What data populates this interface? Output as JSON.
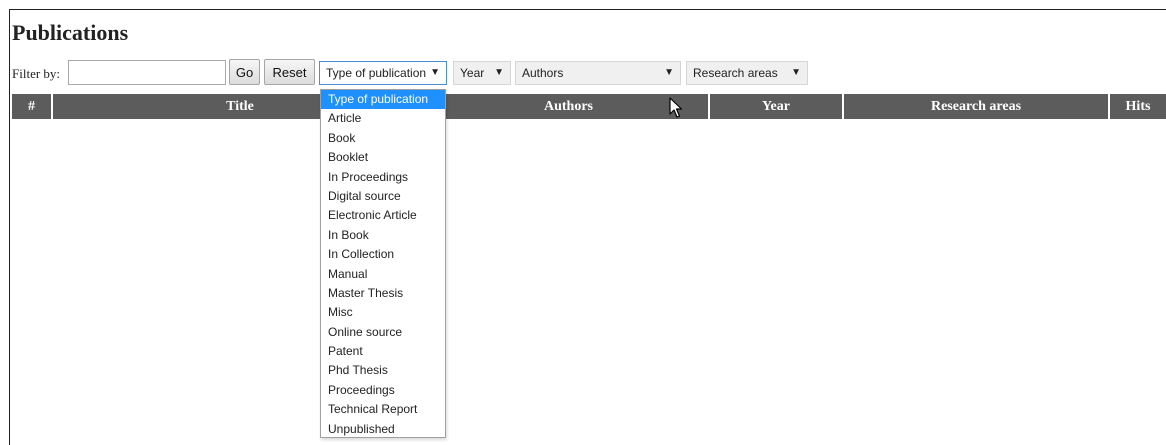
{
  "page": {
    "title": "Publications"
  },
  "filter": {
    "label": "Filter by:",
    "input_value": "",
    "go_label": "Go",
    "reset_label": "Reset"
  },
  "selects": {
    "type": "Type of publication",
    "year": "Year",
    "authors": "Authors",
    "areas": "Research areas"
  },
  "table": {
    "columns": [
      "#",
      "Title",
      "Authors",
      "Year",
      "Research areas",
      "Hits"
    ]
  },
  "dropdown": {
    "selected": "Type of publication",
    "options": [
      "Type of publication",
      "Article",
      "Book",
      "Booklet",
      "In Proceedings",
      "Digital source",
      "Electronic Article",
      "In Book",
      "In Collection",
      "Manual",
      "Master Thesis",
      "Misc",
      "Online source",
      "Patent",
      "Phd Thesis",
      "Proceedings",
      "Technical Report",
      "Unpublished"
    ]
  },
  "colors": {
    "header_bg": "#5c5c5c",
    "selected_option": "#1e90ff"
  },
  "icons": {
    "caret": "caret-down-icon",
    "cursor": "mouse-pointer-icon"
  }
}
